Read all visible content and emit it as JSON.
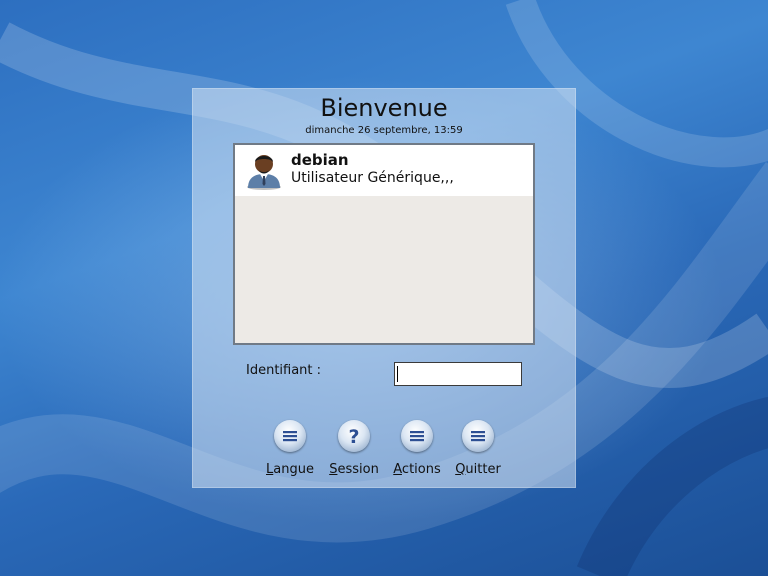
{
  "greeter": {
    "title": "Bienvenue",
    "datetime": "dimanche 26 septembre, 13:59"
  },
  "users": [
    {
      "username": "debian",
      "realname": "Utilisateur Générique,,,",
      "avatar_icon": "user-avatar-icon"
    }
  ],
  "login": {
    "label": "Identifiant :",
    "value": ""
  },
  "actions": [
    {
      "mnemonic": "L",
      "rest": "angue",
      "icon": "menu-icon"
    },
    {
      "mnemonic": "S",
      "rest": "ession",
      "icon": "help-icon"
    },
    {
      "mnemonic": "A",
      "rest": "ctions",
      "icon": "menu-icon"
    },
    {
      "mnemonic": "Q",
      "rest": "uitter",
      "icon": "menu-icon"
    }
  ],
  "colors": {
    "icon_accent": "#2d4f93",
    "list_border": "#707a86"
  }
}
